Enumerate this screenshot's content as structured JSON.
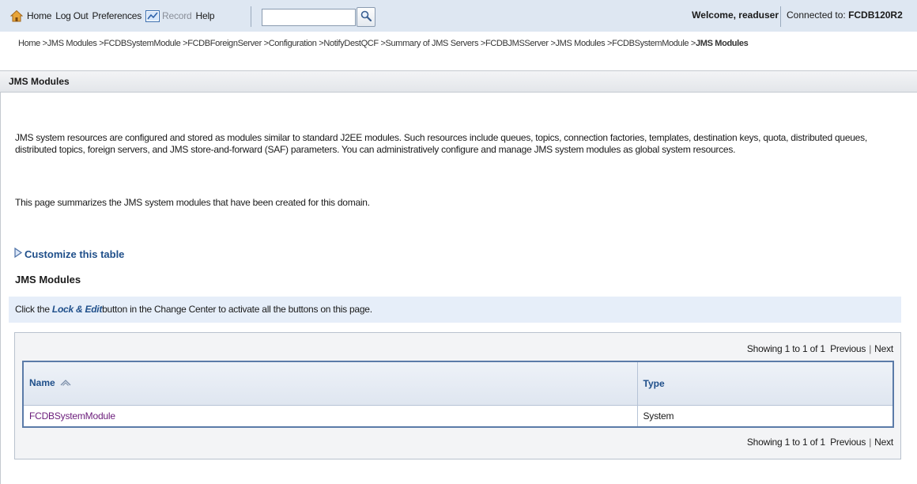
{
  "topbar": {
    "home": "Home",
    "logout": "Log Out",
    "preferences": "Preferences",
    "record": "Record",
    "help": "Help",
    "search_value": "",
    "welcome": "Welcome, readuser",
    "connected_label": "Connected to:",
    "connected_domain": "FCDB120R2",
    "icons": {
      "home": "home-icon",
      "record": "record-icon",
      "search": "search-icon"
    }
  },
  "breadcrumb": {
    "items": [
      "Home",
      "JMS Modules",
      "FCDBSystemModule",
      "FCDBForeignServer",
      "Configuration",
      "NotifyDestQCF",
      "Summary of JMS Servers",
      "FCDBJMSServer",
      "JMS Modules",
      "FCDBSystemModule"
    ],
    "current": "JMS Modules",
    "separator": ">"
  },
  "page": {
    "title": "JMS Modules",
    "description": "JMS system resources are configured and stored as modules similar to standard J2EE modules. Such resources include queues, topics, connection factories, templates, destination keys, quota, distributed queues, distributed topics, foreign servers, and JMS store-and-forward (SAF) parameters. You can administratively configure and manage JMS system modules as global system resources.",
    "summary": "This page summarizes the JMS system modules that have been created for this domain.",
    "customize_link": "Customize this table"
  },
  "table": {
    "title": "JMS Modules",
    "hint_prefix": "Click the",
    "hint_emph": "Lock & Edit",
    "hint_suffix": "button in the Change Center to activate all the buttons on this page.",
    "pager": {
      "showing": "Showing 1 to 1 of 1",
      "previous": "Previous",
      "next": "Next"
    },
    "columns": [
      "Name",
      "Type"
    ],
    "rows": [
      {
        "name": "FCDBSystemModule",
        "type": "System"
      }
    ]
  },
  "colors": {
    "topbar_bg": "#dee7f2",
    "link_blue": "#1f4f8a",
    "visited_link": "#6a1b7a",
    "table_border": "#5b7ba8",
    "hint_bg": "#e6eef9"
  }
}
